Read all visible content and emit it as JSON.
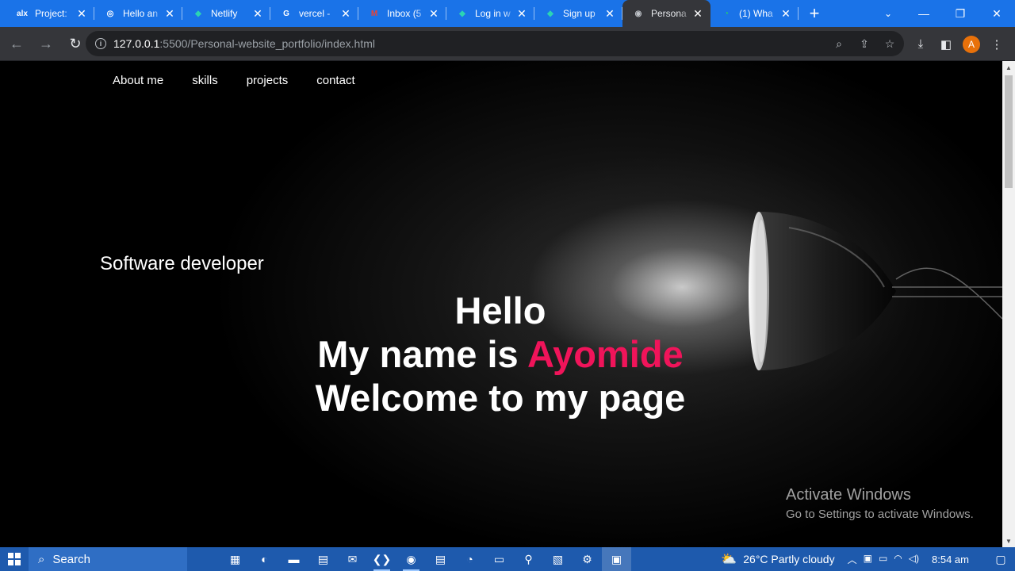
{
  "browser": {
    "tabs": [
      {
        "title": "Project:",
        "icon": "alx-icon",
        "favicon_text": "alx",
        "favicon_color": "#ffffff"
      },
      {
        "title": "Hello an",
        "icon": "openai-icon",
        "favicon_text": "◎",
        "favicon_color": "#ffffff"
      },
      {
        "title": "Netlify",
        "icon": "netlify-icon",
        "favicon_text": "◆",
        "favicon_color": "#2bd4b4"
      },
      {
        "title": "vercel -",
        "icon": "google-icon",
        "favicon_text": "G",
        "favicon_color": "#ffffff"
      },
      {
        "title": "Inbox (5",
        "icon": "gmail-icon",
        "favicon_text": "M",
        "favicon_color": "#ea4335"
      },
      {
        "title": "Log in w",
        "icon": "netlify-icon",
        "favicon_text": "◆",
        "favicon_color": "#2bd4b4"
      },
      {
        "title": "Sign up",
        "icon": "netlify-icon",
        "favicon_text": "◆",
        "favicon_color": "#2bd4b4"
      },
      {
        "title": "Persona",
        "icon": "globe-icon",
        "favicon_text": "◉",
        "favicon_color": "#bdc1c6",
        "active": true
      },
      {
        "title": "(1) Wha",
        "icon": "whatsapp-icon",
        "favicon_text": "◔",
        "favicon_color": "#25d366"
      }
    ],
    "close_glyph": "✕",
    "new_tab_glyph": "+",
    "url_host": "127.0.0.1",
    "url_rest": ":5500/Personal-website_portfolio/index.html",
    "profile_initial": "A",
    "accent_color": "#1a73e8"
  },
  "site": {
    "nav": [
      "About me",
      "skills",
      "projects",
      "contact"
    ],
    "role": "Software developer",
    "hero": {
      "line1": "Hello",
      "line2_prefix": "My name is ",
      "line2_name": "Ayomide",
      "line3": "Welcome to my page"
    },
    "name_color": "#f0145a"
  },
  "watermark": {
    "title": "Activate Windows",
    "subtitle": "Go to Settings to activate Windows."
  },
  "taskbar": {
    "search_label": "Search",
    "weather": "26°C  Partly cloudy",
    "time": "8:54 am",
    "apps": [
      "thumbnail-icon",
      "edge-icon",
      "file-explorer-icon",
      "store-icon",
      "mail-icon",
      "vscode-icon",
      "chrome-icon",
      "notes-icon",
      "whatsapp-icon",
      "terminal-icon",
      "python-icon",
      "app-icon",
      "app2-icon",
      "photos-icon"
    ]
  }
}
